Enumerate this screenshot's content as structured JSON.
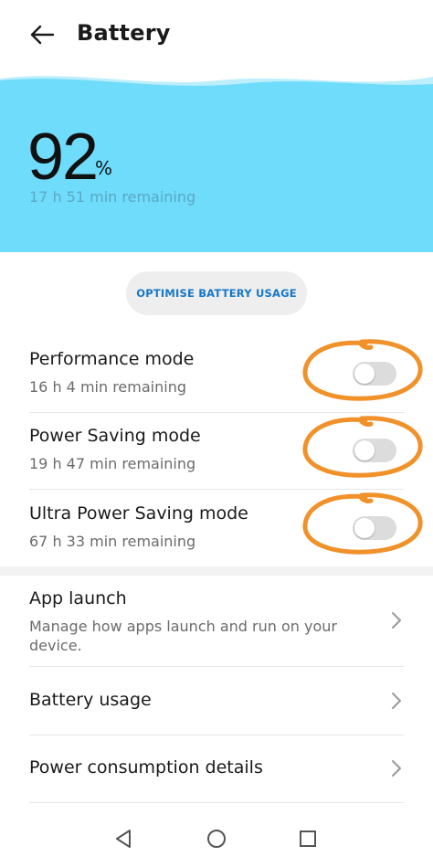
{
  "header": {
    "title": "Battery",
    "back_icon": "arrow-left-icon"
  },
  "battery": {
    "percent": "92",
    "percent_sign": "%",
    "remaining": "17 h 51 min remaining",
    "level": 0.92,
    "colors": {
      "wave": "#6fdcfb",
      "wave_light": "#bdeefc"
    }
  },
  "optimise_button": {
    "label": "OPTIMISE BATTERY USAGE"
  },
  "modes": [
    {
      "title": "Performance mode",
      "remaining": "16 h 4 min remaining",
      "enabled": false
    },
    {
      "title": "Power Saving mode",
      "remaining": "19 h 47 min remaining",
      "enabled": false
    },
    {
      "title": "Ultra Power Saving mode",
      "remaining": "67 h 33 min remaining",
      "enabled": false
    }
  ],
  "annotation_color": "#f0912a",
  "nav_items": [
    {
      "title": "App launch",
      "description": "Manage how apps launch and run on your device.",
      "icon": "chevron-right-icon"
    },
    {
      "title": "Battery usage",
      "description": "",
      "icon": "chevron-right-icon"
    },
    {
      "title": "Power consumption details",
      "description": "",
      "icon": "chevron-right-icon"
    }
  ],
  "system_nav": {
    "back_icon": "triangle-back-icon",
    "home_icon": "circle-home-icon",
    "recents_icon": "square-recents-icon"
  }
}
